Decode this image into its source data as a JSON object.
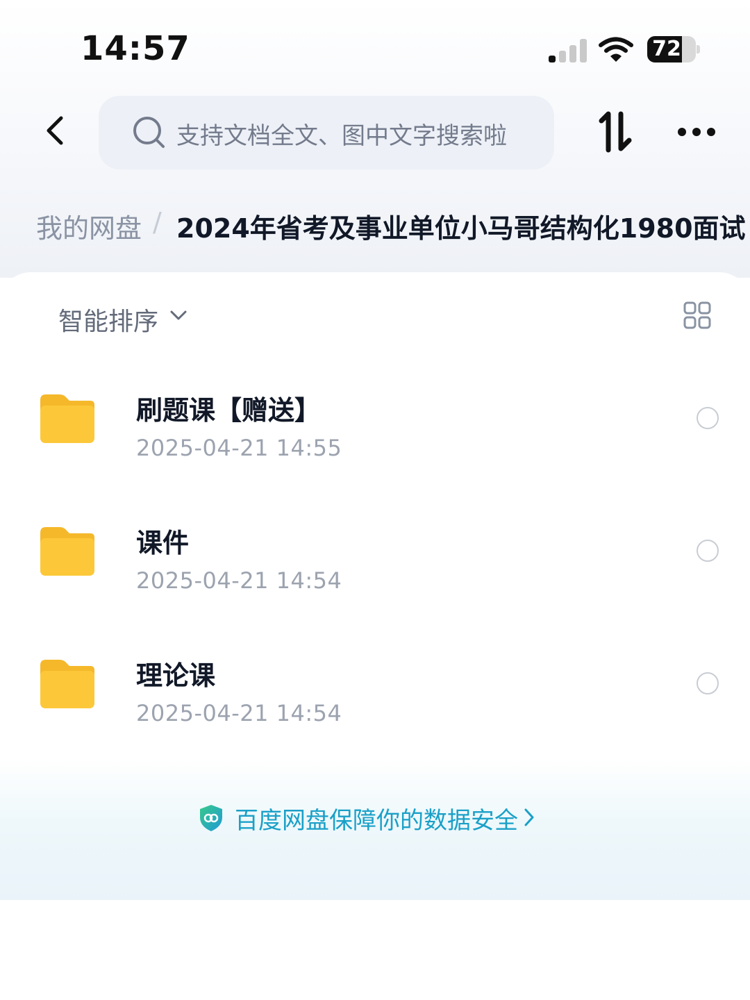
{
  "status_bar": {
    "time": "14:57",
    "battery": "72",
    "battery_level": 0.72
  },
  "header": {
    "search_placeholder": "支持文档全文、图中文字搜索啦"
  },
  "breadcrumb": {
    "root": "我的网盘",
    "separator": "/",
    "current": "2024年省考及事业单位小马哥结构化1980面试"
  },
  "toolbar": {
    "sort_label": "智能排序"
  },
  "files": [
    {
      "name": "刷题课【赠送】",
      "date": "2025-04-21 14:55",
      "type": "folder-icon"
    },
    {
      "name": "课件",
      "date": "2025-04-21 14:54",
      "type": "folder-icon"
    },
    {
      "name": "理论课",
      "date": "2025-04-21 14:54",
      "type": "folder-icon"
    }
  ],
  "footer": {
    "security_text": "百度网盘保障你的数据安全"
  },
  "colors": {
    "accent": "#1aa0c8",
    "folder": "#fcc435",
    "text": "#111827",
    "muted": "#9ca3af"
  }
}
